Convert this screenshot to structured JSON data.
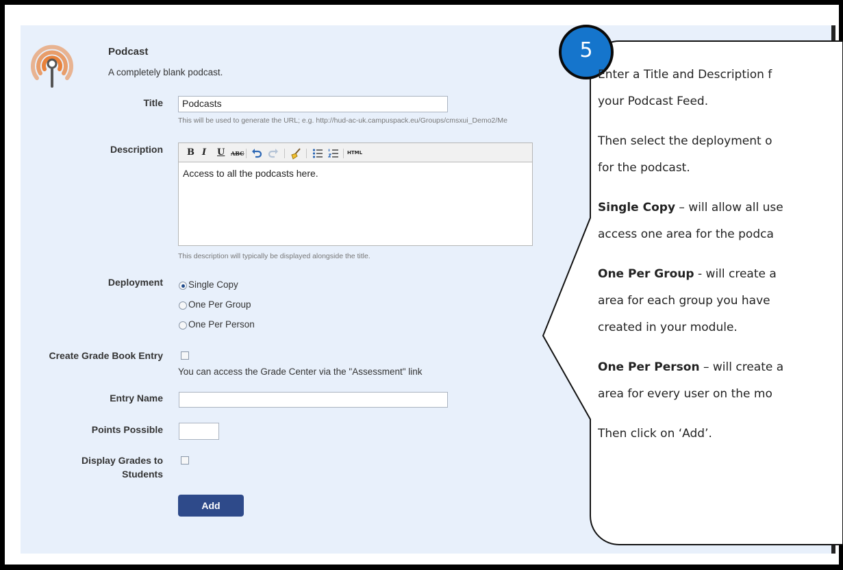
{
  "tool": {
    "icon": "podcast-icon",
    "title": "Podcast",
    "description": "A completely blank podcast."
  },
  "form": {
    "title_label": "Title",
    "title_value": "Podcasts",
    "title_hint": "This will be used to generate the URL; e.g. http://hud-ac-uk.campuspack.eu/Groups/cmsxui_Demo2/Me",
    "description_label": "Description",
    "description_value": "Access to all the podcasts here.",
    "description_hint": "This description will typically be displayed alongside the title.",
    "editor_toolbar": [
      "B",
      "I",
      "U",
      "ABC",
      "undo",
      "redo",
      "clean",
      "bullet-list",
      "numbered-list",
      "HTML"
    ],
    "deployment_label": "Deployment",
    "deployment_options": [
      "Single Copy",
      "One Per Group",
      "One Per Person"
    ],
    "deployment_selected": "Single Copy",
    "gradebook_label": "Create Grade Book Entry",
    "gradebook_hint": "You can access the Grade Center via the \"Assessment\" link",
    "entry_name_label": "Entry Name",
    "entry_name_value": "",
    "points_label": "Points Possible",
    "points_value": "",
    "display_grades_label_1": "Display Grades to",
    "display_grades_label_2": "Students",
    "add_label": "Add"
  },
  "callout": {
    "step": "5",
    "line1": "Enter a Title and Description f",
    "line2": "your Podcast Feed.",
    "line3": "Then select the deployment o",
    "line4": "for the podcast.",
    "single_bold": "Single Copy",
    "single_rest": " – will allow all use",
    "single_line2": "access one area for the podca",
    "group_bold": "One Per Group",
    "group_rest": " -  will create a",
    "group_line2": "area for each group you have",
    "group_line3": "created in your module.",
    "person_bold": "One Per Person",
    "person_rest": " – will create a",
    "person_line2": "area for every user on the mo",
    "final": "Then click on ‘Add’."
  },
  "colors": {
    "panel_bg": "#e8f0fb",
    "button_bg": "#2e4a8a",
    "badge_bg": "#1575cc",
    "podcast_icon": "#e8813a"
  }
}
